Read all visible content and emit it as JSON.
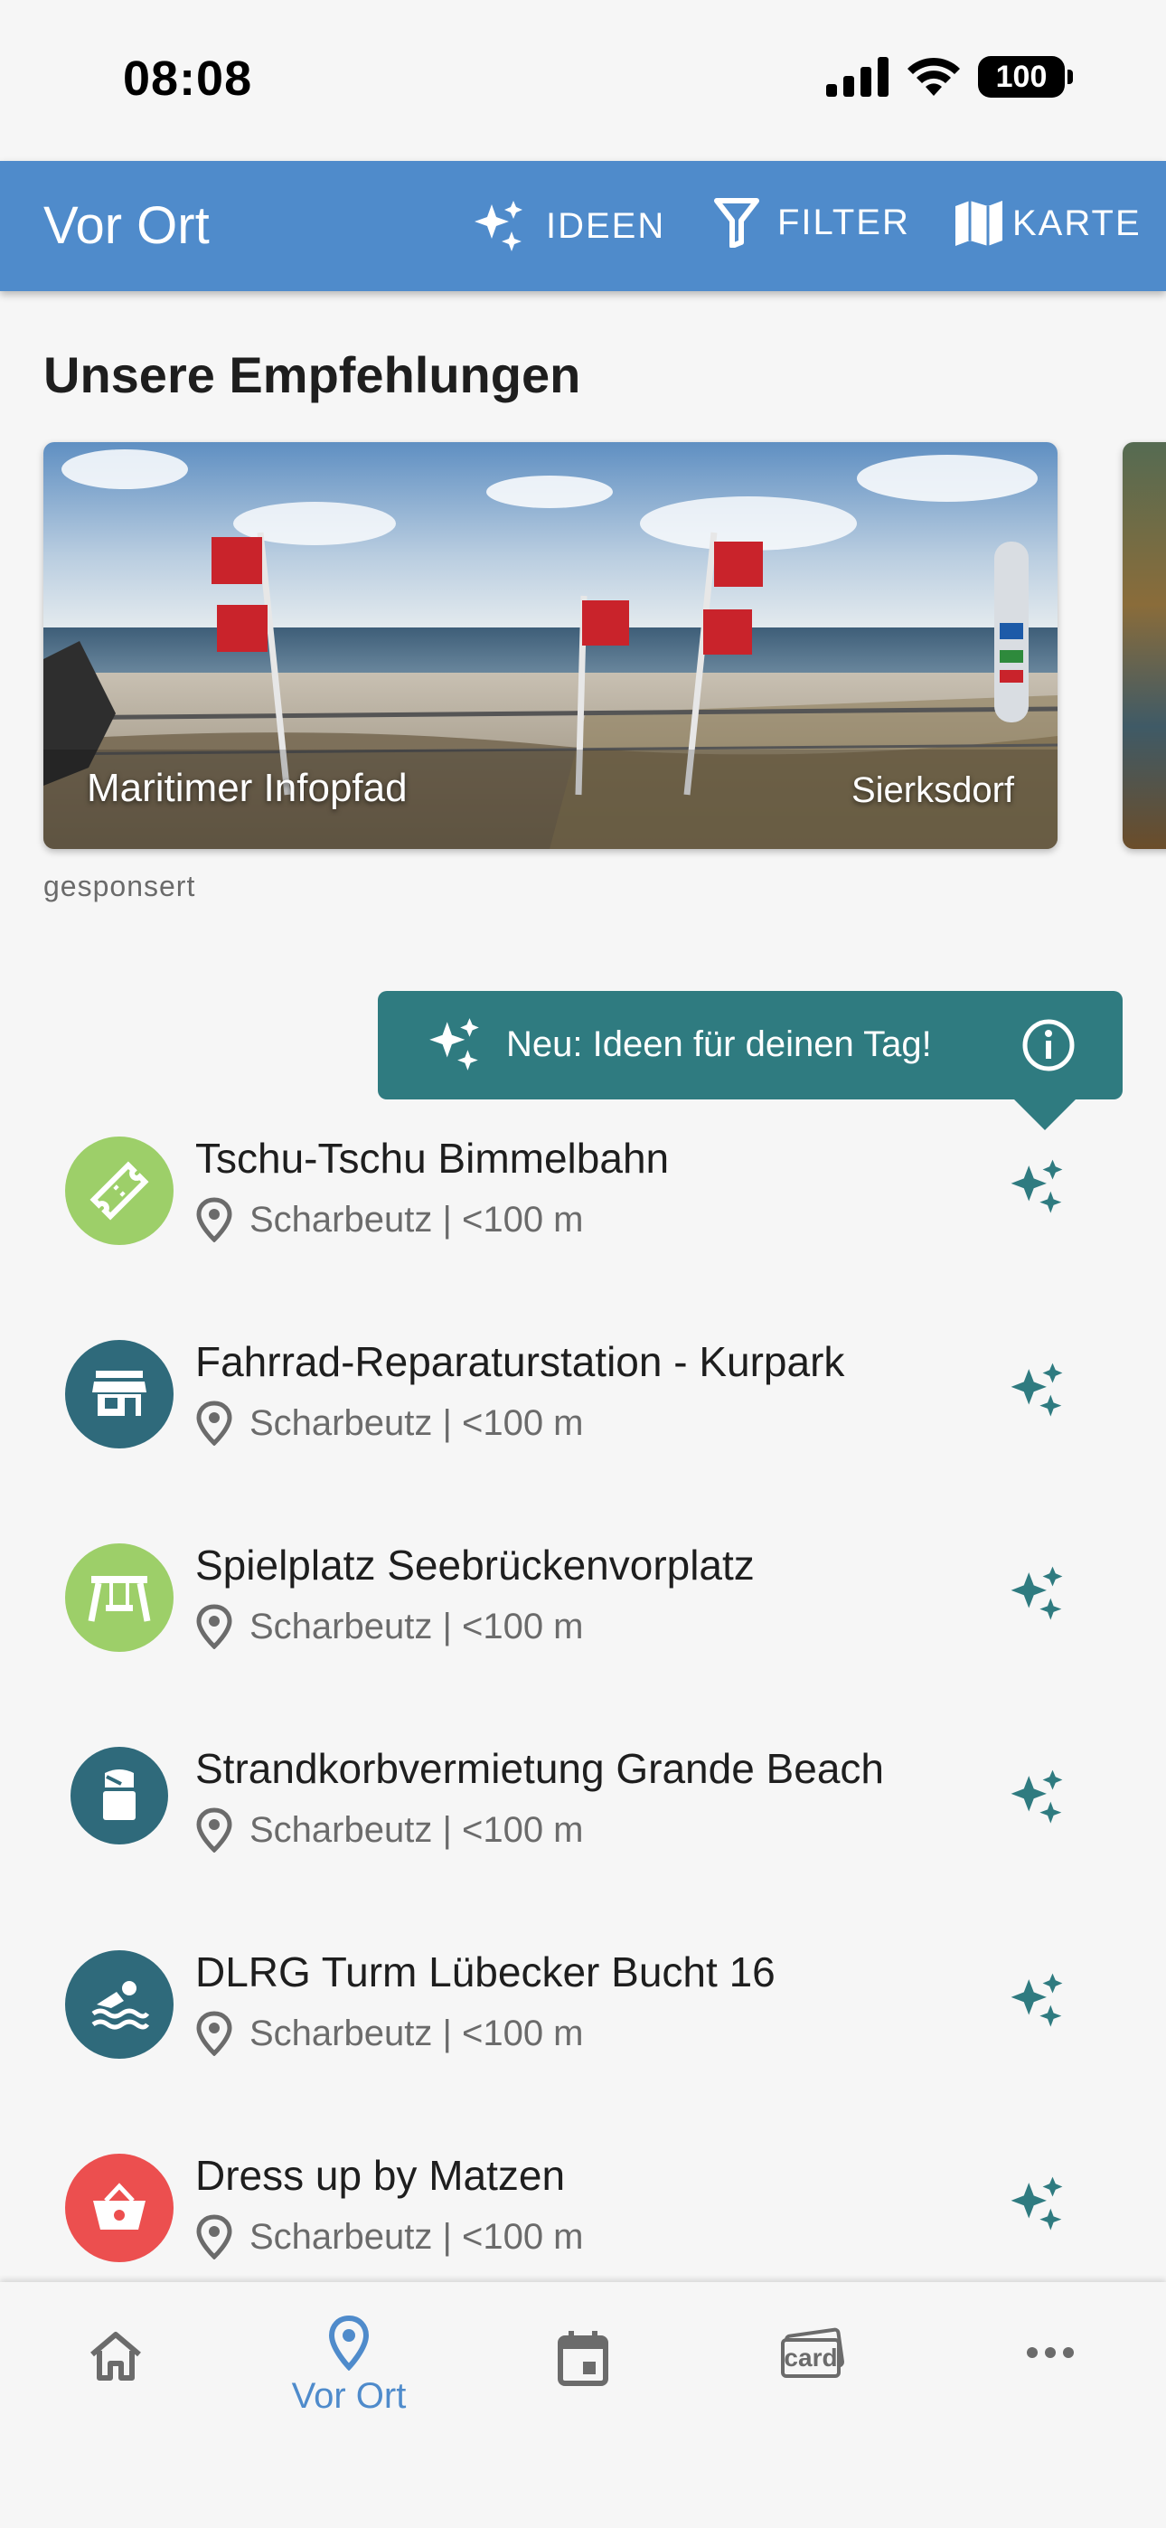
{
  "status_bar": {
    "time": "08:08",
    "battery": "100"
  },
  "app_bar": {
    "title": "Vor Ort",
    "actions": {
      "ideas": "IDEEN",
      "filter": "FILTER",
      "map": "KARTE"
    }
  },
  "recommendations": {
    "heading": "Unsere Empfehlungen",
    "card": {
      "name": "Maritimer Infopfad",
      "place": "Sierksdorf"
    },
    "sponsored_label": "gesponsert"
  },
  "tooltip": {
    "text": "Neu: Ideen für deinen Tag!"
  },
  "list": [
    {
      "title": "Tschu-Tschu Bimmelbahn",
      "subtitle": "Scharbeutz | <100 m",
      "icon": "ticket-icon",
      "color": "#9dcf69"
    },
    {
      "title": "Fahrrad-Reparaturstation - Kurpark",
      "subtitle": "Scharbeutz | <100 m",
      "icon": "store-icon",
      "color": "#2f6a7b"
    },
    {
      "title": "Spielplatz Seebrückenvorplatz",
      "subtitle": "Scharbeutz | <100 m",
      "icon": "swing-icon",
      "color": "#9dcf69"
    },
    {
      "title": "Strandkorbvermietung Grande Beach",
      "subtitle": "Scharbeutz | <100 m",
      "icon": "beach-chair-icon",
      "color": "#2f6a7b"
    },
    {
      "title": "DLRG Turm Lübecker Bucht 16",
      "subtitle": "Scharbeutz | <100 m",
      "icon": "swimmer-icon",
      "color": "#2f6a7b"
    },
    {
      "title": "Dress up by Matzen",
      "subtitle": "Scharbeutz | <100 m",
      "icon": "shopping-basket-icon",
      "color": "#ec4f4f"
    }
  ],
  "bottom_nav": {
    "home": "",
    "vor_ort": "Vor Ort",
    "calendar": "",
    "card": "card",
    "more": ""
  },
  "colors": {
    "primary": "#4f8bcb",
    "teal": "#2f7b80",
    "background": "#f6f6f6"
  }
}
